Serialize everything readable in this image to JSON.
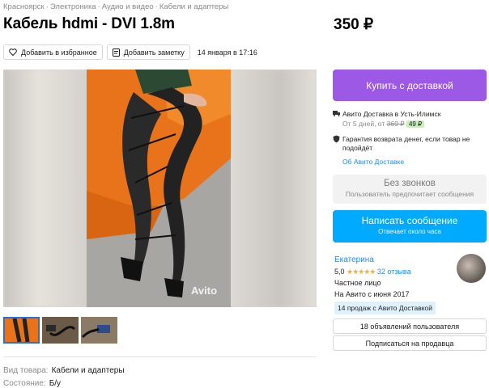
{
  "breadcrumb": {
    "items": [
      "Красноярск",
      "Электроника",
      "Аудио и видео",
      "Кабели и адаптеры"
    ],
    "separator": "·"
  },
  "listing": {
    "title": "Кабель hdmi - DVI 1.8m",
    "price": "350 ₽",
    "favorite_label": "Добавить в избранное",
    "note_label": "Добавить заметку",
    "date": "14 января в 17:16",
    "watermark": "Avito"
  },
  "params": [
    {
      "label": "Вид товара:",
      "value": "Кабели и адаптеры"
    },
    {
      "label": "Состояние:",
      "value": "Б/у"
    }
  ],
  "purchase": {
    "buy_label": "Купить с доставкой",
    "delivery_title": "Авито Доставка в Усть-Илимск",
    "delivery_days": "От 5 дней, от",
    "old_price": "369 ₽",
    "new_price": "49 ₽",
    "guarantee": "Гарантия возврата денег, если товар не подойдёт",
    "about_link": "Об Авито Доставке",
    "no_calls_title": "Без звонков",
    "no_calls_sub": "Пользователь предпочитает сообщения",
    "message_label": "Написать сообщение",
    "message_sub": "Отвечает около часа"
  },
  "seller": {
    "name": "Екатерина",
    "rating": "5,0",
    "stars": "★★★★★",
    "reviews": "32 отзыва",
    "type": "Частное лицо",
    "since": "На Авито с июня 2017",
    "sales_badge": "14 продаж с Авито Доставкой",
    "ads_button": "18 объявлений пользователя",
    "subscribe_button": "Подписаться на продавца"
  },
  "colors": {
    "buy_button": "#9b59e6",
    "message_button": "#00aaff",
    "link": "#1a8cff",
    "stars": "#ffb021"
  }
}
